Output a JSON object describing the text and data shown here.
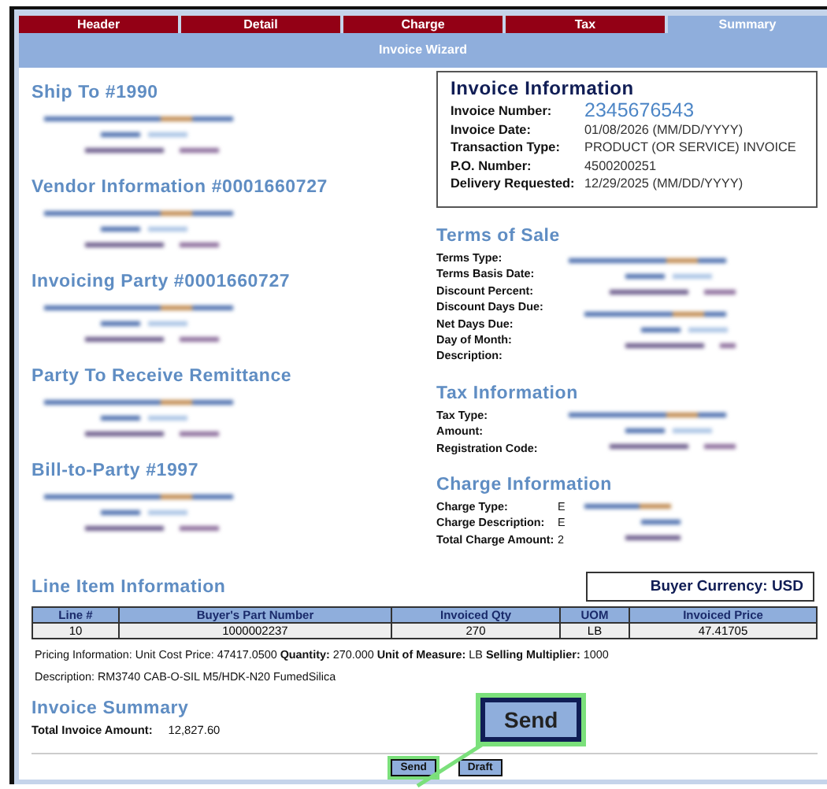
{
  "tabs": [
    {
      "label": "Header",
      "selected": false
    },
    {
      "label": "Detail",
      "selected": false
    },
    {
      "label": "Charge",
      "selected": false
    },
    {
      "label": "Tax",
      "selected": false
    },
    {
      "label": "Summary",
      "selected": true
    }
  ],
  "wizard_title": "Invoice Wizard",
  "parties": [
    {
      "title": "Ship To #1990"
    },
    {
      "title": "Vendor Information #0001660727"
    },
    {
      "title": "Invoicing Party #0001660727"
    },
    {
      "title": "Party To Receive Remittance"
    },
    {
      "title": "Bill-to-Party #1997"
    }
  ],
  "invoice_information": {
    "title": "Invoice Information",
    "fields": [
      {
        "label": "Invoice Number:",
        "value": "2345676543",
        "kind": "highlight"
      },
      {
        "label": "Invoice Date:",
        "value": "01/08/2026  (MM/DD/YYYY)",
        "kind": "plain"
      },
      {
        "label": "Transaction Type:",
        "value": "PRODUCT (OR SERVICE) INVOICE",
        "kind": "plain"
      },
      {
        "label": "P.O. Number:",
        "value": "4500200251",
        "kind": "plain"
      },
      {
        "label": "Delivery Requested:",
        "value": "12/29/2025  (MM/DD/YYYY)",
        "kind": "plain"
      }
    ]
  },
  "detail_sections": [
    {
      "title": "Terms of Sale",
      "fields": [
        {
          "label": "Terms Type:"
        },
        {
          "label": "Terms Basis Date:"
        },
        {
          "label": "Discount Percent:"
        },
        {
          "label": "Discount Days Due:"
        },
        {
          "label": "Net Days Due:"
        },
        {
          "label": "Day of Month:"
        },
        {
          "label": "Description:"
        }
      ]
    },
    {
      "title": "Tax Information",
      "fields": [
        {
          "label": "Tax Type:"
        },
        {
          "label": "Amount:"
        },
        {
          "label": "Registration Code:"
        }
      ]
    },
    {
      "title": "Charge Information",
      "fields": [
        {
          "label": "Charge Type:",
          "value": "E"
        },
        {
          "label": "Charge Description:",
          "value": "E"
        },
        {
          "label": "Total Charge Amount:",
          "value": "2"
        }
      ]
    }
  ],
  "line_items": {
    "title": "Line Item Information",
    "currency": "Buyer Currency: USD",
    "columns": [
      "Line #",
      "Buyer's Part Number",
      "Invoiced Qty",
      "UOM",
      "Invoiced Price"
    ],
    "rows": [
      [
        "10",
        "1000002237",
        "270",
        "LB",
        "47.41705"
      ]
    ],
    "pricing": "Pricing Information: Unit Cost Price: 47417.0500 **Quantity:** 270.000 **Unit of Measure:** LB **Selling Multiplier:** 1000",
    "description": "Description: RM3740 CAB-O-SIL M5/HDK-N20 FumedSilica"
  },
  "summary": {
    "title": "Invoice Summary",
    "label": "Total Invoice Amount:",
    "value": "12,827.60"
  },
  "callout": {
    "label": "Send"
  },
  "buttons": [
    "Send",
    "Draft"
  ]
}
